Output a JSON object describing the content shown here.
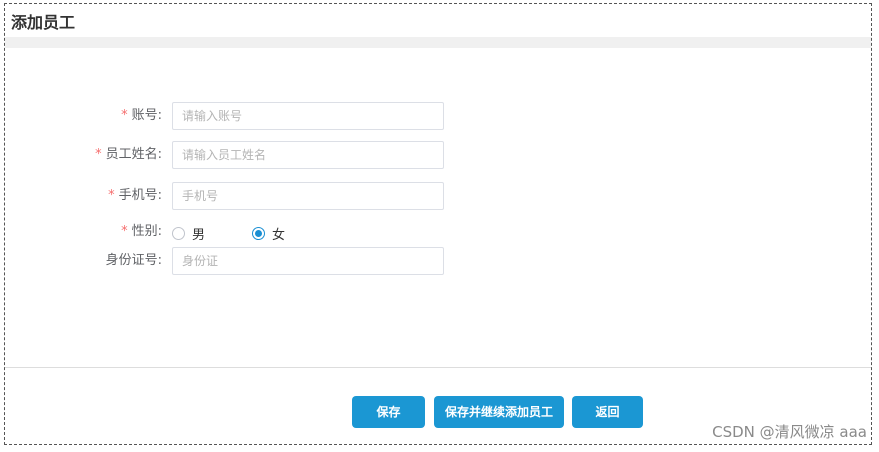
{
  "page": {
    "title": "添加员工"
  },
  "form": {
    "account": {
      "label": "账号:",
      "placeholder": "请输入账号",
      "required": true
    },
    "name": {
      "label": "员工姓名:",
      "placeholder": "请输入员工姓名",
      "required": true
    },
    "phone": {
      "label": "手机号:",
      "placeholder": "手机号",
      "required": true
    },
    "gender": {
      "label": "性别:",
      "required": true,
      "options": [
        "男",
        "女"
      ],
      "selected": "女"
    },
    "id_card": {
      "label": "身份证号:",
      "placeholder": "身份证",
      "required": false
    },
    "required_mark": "*"
  },
  "buttons": {
    "save": "保存",
    "save_continue": "保存并继续添加员工",
    "back": "返回"
  },
  "watermark": "CSDN @清风微凉 aaa",
  "colors": {
    "primary": "#1b97d3",
    "required": "#f56c6c",
    "radio_checked": "#1a8fd3"
  }
}
